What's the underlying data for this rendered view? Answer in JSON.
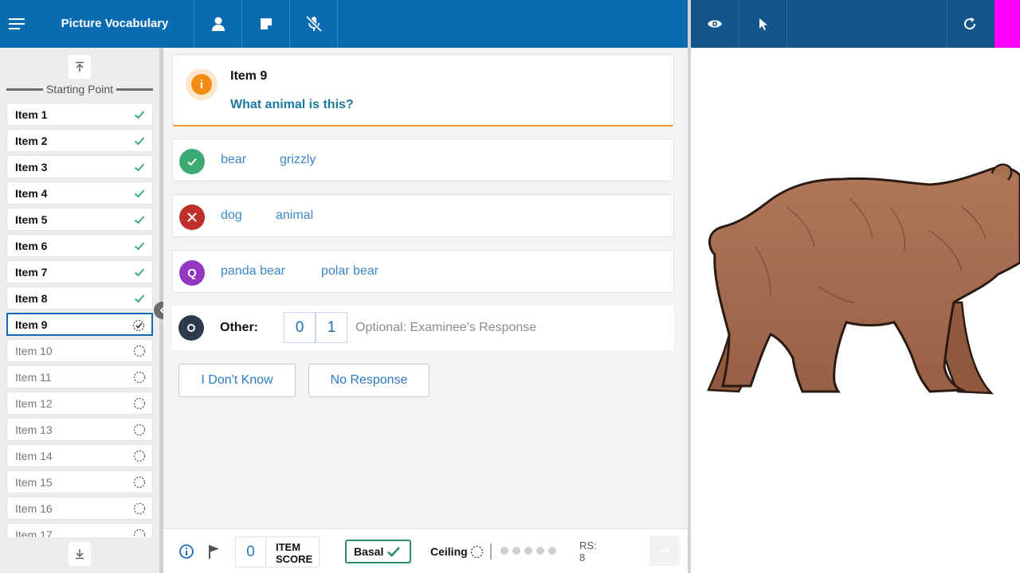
{
  "header": {
    "title": "Picture Vocabulary",
    "icons": [
      "menu-icon",
      "person-icon",
      "note-icon",
      "mic-off-icon"
    ]
  },
  "right_header": {
    "icons": [
      "eye-icon",
      "pointer-icon",
      "refresh-icon"
    ],
    "accent_color": "#ff00ff"
  },
  "sidebar": {
    "starting_point_label": "Starting Point",
    "items": [
      {
        "label": "Item 1",
        "status": "done"
      },
      {
        "label": "Item 2",
        "status": "done"
      },
      {
        "label": "Item 3",
        "status": "done"
      },
      {
        "label": "Item 4",
        "status": "done"
      },
      {
        "label": "Item 5",
        "status": "done"
      },
      {
        "label": "Item 6",
        "status": "done"
      },
      {
        "label": "Item 7",
        "status": "done"
      },
      {
        "label": "Item 8",
        "status": "done"
      },
      {
        "label": "Item 9",
        "status": "current"
      },
      {
        "label": "Item 10",
        "status": "todo"
      },
      {
        "label": "Item 11",
        "status": "todo"
      },
      {
        "label": "Item 12",
        "status": "todo"
      },
      {
        "label": "Item 13",
        "status": "todo"
      },
      {
        "label": "Item 14",
        "status": "todo"
      },
      {
        "label": "Item 15",
        "status": "todo"
      },
      {
        "label": "Item 16",
        "status": "todo"
      },
      {
        "label": "Item 17",
        "status": "todo"
      }
    ]
  },
  "question": {
    "item_title": "Item 9",
    "prompt": "What animal is this?"
  },
  "responses": {
    "correct": {
      "answers": [
        "bear",
        "grizzly"
      ],
      "color": "#3daa74"
    },
    "incorrect": {
      "answers": [
        "dog",
        "animal"
      ],
      "color": "#c0302b"
    },
    "query": {
      "answers": [
        "panda bear",
        "polar bear"
      ],
      "color": "#9438c2",
      "symbol": "Q"
    },
    "other": {
      "label": "Other:",
      "score_options": [
        "0",
        "1"
      ],
      "placeholder": "Optional: Examinee's Response"
    }
  },
  "actions": {
    "dont_know": "I Don't Know",
    "no_response": "No Response"
  },
  "footer": {
    "item_score_value": "0",
    "item_score_label_1": "ITEM",
    "item_score_label_2": "SCORE",
    "basal_label": "Basal",
    "ceiling_label": "Ceiling",
    "ceiling_dots": 5,
    "rs_label": "RS:",
    "rs_value": "8"
  },
  "stimulus": {
    "image": "brown bear"
  }
}
